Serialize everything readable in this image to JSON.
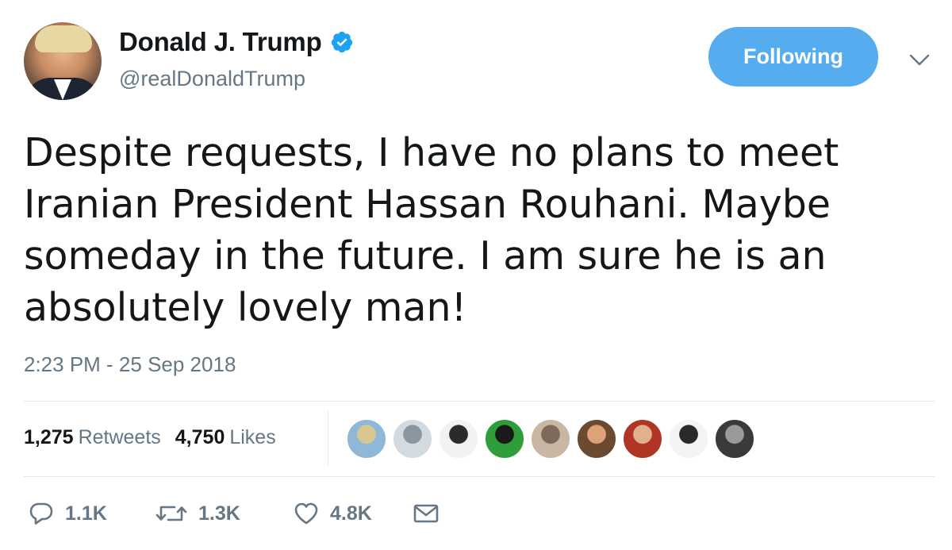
{
  "author": {
    "name": "Donald J. Trump",
    "handle": "@realDonaldTrump",
    "verified": true,
    "avatar_icon": "profile-photo"
  },
  "follow_button": {
    "label": "Following",
    "color": "#55acee"
  },
  "menu_icon": "chevron-down-icon",
  "tweet": {
    "lines": [
      "Despite requests, I have no plans to meet",
      "Iranian President Hassan Rouhani. Maybe",
      "someday in the future. I am sure he is an",
      "absolutely lovely man!"
    ],
    "timestamp": "2:23 PM - 25 Sep 2018"
  },
  "stats": {
    "retweets_count": "1,275",
    "retweets_label": "Retweets",
    "likes_count": "4,750",
    "likes_label": "Likes"
  },
  "likers": [
    {
      "name": "liker-avatar-1",
      "colors": [
        "#8fb8d8",
        "#d8c890"
      ]
    },
    {
      "name": "liker-avatar-2",
      "colors": [
        "#d3dbe1",
        "#8a96a0"
      ]
    },
    {
      "name": "liker-avatar-3",
      "colors": [
        "#f2f2f2",
        "#2b2b2b"
      ]
    },
    {
      "name": "liker-avatar-4",
      "colors": [
        "#2e9e3a",
        "#1a1a1a"
      ]
    },
    {
      "name": "liker-avatar-5",
      "colors": [
        "#c9b7a3",
        "#7d6a5a"
      ]
    },
    {
      "name": "liker-avatar-6",
      "colors": [
        "#6b4a2f",
        "#e0a176"
      ]
    },
    {
      "name": "liker-avatar-7",
      "colors": [
        "#b03524",
        "#e2b08c"
      ]
    },
    {
      "name": "liker-avatar-8",
      "colors": [
        "#f4f4f4",
        "#2a2a2a"
      ]
    },
    {
      "name": "liker-avatar-9",
      "colors": [
        "#3a3a3a",
        "#9a9a9a"
      ]
    }
  ],
  "actions": {
    "replies": "1.1K",
    "retweets": "1.3K",
    "likes": "4.8K"
  },
  "colors": {
    "text": "#14171a",
    "secondary": "#657786",
    "accent": "#1da1f2",
    "divider": "#e1e8ed"
  }
}
